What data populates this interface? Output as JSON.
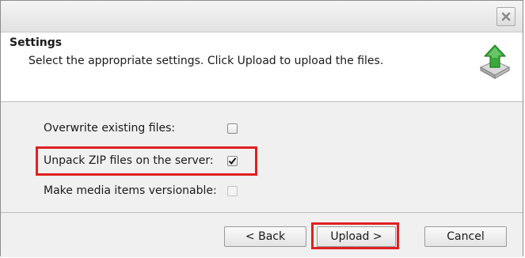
{
  "window": {
    "close_icon": "close-icon"
  },
  "header": {
    "title": "Settings",
    "description": "Select the appropriate settings. Click Upload to upload the files.",
    "icon": "upload-arrow-icon"
  },
  "options": [
    {
      "label": "Overwrite existing files:",
      "checked": false,
      "enabled": true
    },
    {
      "label": "Unpack ZIP files on the server:",
      "checked": true,
      "enabled": true,
      "highlighted": true
    },
    {
      "label": "Make media items versionable:",
      "checked": false,
      "enabled": false
    }
  ],
  "buttons": {
    "back": "< Back",
    "upload": "Upload >",
    "cancel": "Cancel"
  },
  "colors": {
    "highlight": "#e02020",
    "icon_green": "#3aa83a"
  }
}
